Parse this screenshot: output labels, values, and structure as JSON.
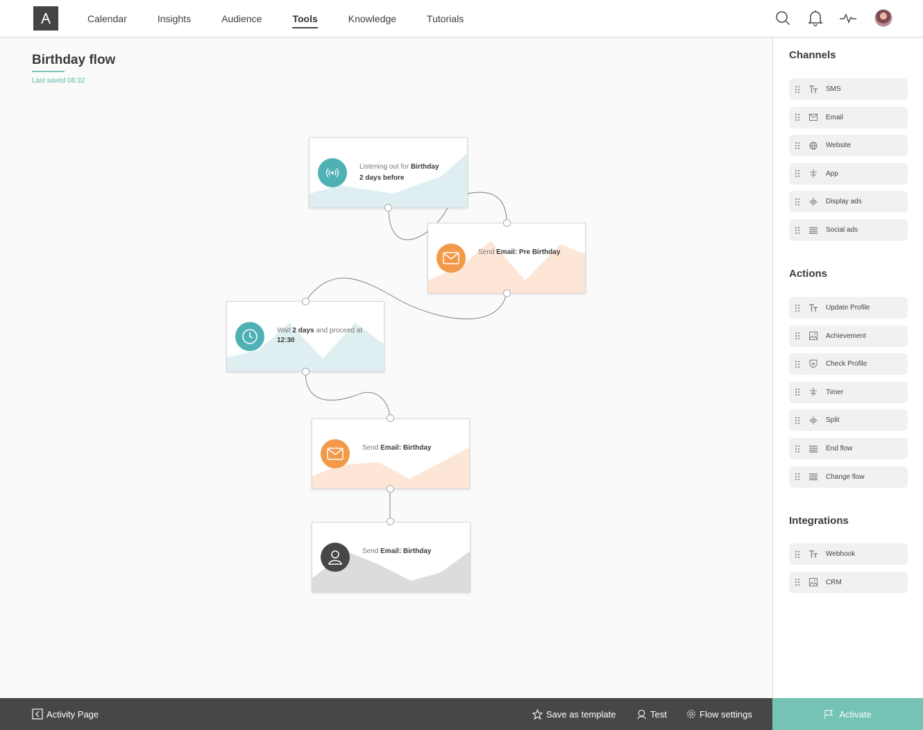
{
  "nav": {
    "items": [
      {
        "label": "Calendar",
        "active": false
      },
      {
        "label": "Insights",
        "active": false
      },
      {
        "label": "Audience",
        "active": false
      },
      {
        "label": "Tools",
        "active": true
      },
      {
        "label": "Knowledge",
        "active": false
      },
      {
        "label": "Tutorials",
        "active": false
      }
    ],
    "icons": [
      "search-icon",
      "bell-icon",
      "activity-icon",
      "avatar"
    ]
  },
  "flow": {
    "title": "Birthday flow",
    "last_saved": "Last saved 08:32",
    "nodes": [
      {
        "id": "trigger",
        "type": "listener",
        "pre": "Listening out for ",
        "bold": "Birthday",
        "line2": "2 days before",
        "color": "#4fb1b4"
      },
      {
        "id": "pre-email",
        "type": "email",
        "pre": "Send ",
        "bold": "Email: Pre Birthday",
        "color": "#f2994a"
      },
      {
        "id": "wait",
        "type": "timer",
        "pre": "Wait ",
        "bold": "2 days",
        "mid": " and proceed at ",
        "bold2": "12:30",
        "color": "#4fb1b4"
      },
      {
        "id": "email",
        "type": "email",
        "pre": "Send ",
        "bold": "Email: Birthday",
        "color": "#f2994a"
      },
      {
        "id": "profile",
        "type": "profile",
        "pre": "Send ",
        "bold": "Email: Birthday",
        "color": "#474747"
      }
    ]
  },
  "sidebar": {
    "channels_title": "Channels",
    "channels": [
      {
        "label": "SMS",
        "icon": "text-icon"
      },
      {
        "label": "Email",
        "icon": "mail-icon"
      },
      {
        "label": "Website",
        "icon": "globe-icon"
      },
      {
        "label": "App",
        "icon": "app-icon"
      },
      {
        "label": "Display ads",
        "icon": "split-icon"
      },
      {
        "label": "Social ads",
        "icon": "list-icon"
      }
    ],
    "actions_title": "Actions",
    "actions": [
      {
        "label": "Update Profile",
        "icon": "text-icon"
      },
      {
        "label": "Achievement",
        "icon": "image-icon"
      },
      {
        "label": "Check Profile",
        "icon": "shield-icon"
      },
      {
        "label": "Timer",
        "icon": "app-icon"
      },
      {
        "label": "Split",
        "icon": "split-icon"
      },
      {
        "label": "End flow",
        "icon": "list-icon"
      },
      {
        "label": "Change flow",
        "icon": "list-icon"
      }
    ],
    "integrations_title": "Integrations",
    "integrations": [
      {
        "label": "Webhook",
        "icon": "text-icon"
      },
      {
        "label": "CRM",
        "icon": "image-icon"
      }
    ]
  },
  "bottombar": {
    "activity_page": "Activity Page",
    "save_template": "Save as template",
    "test": "Test",
    "flow_settings": "Flow settings",
    "activate": "Activate"
  },
  "colors": {
    "teal": "#4fb1b4",
    "orange": "#f2994a",
    "dark": "#474747",
    "accent": "#74c3b4"
  }
}
